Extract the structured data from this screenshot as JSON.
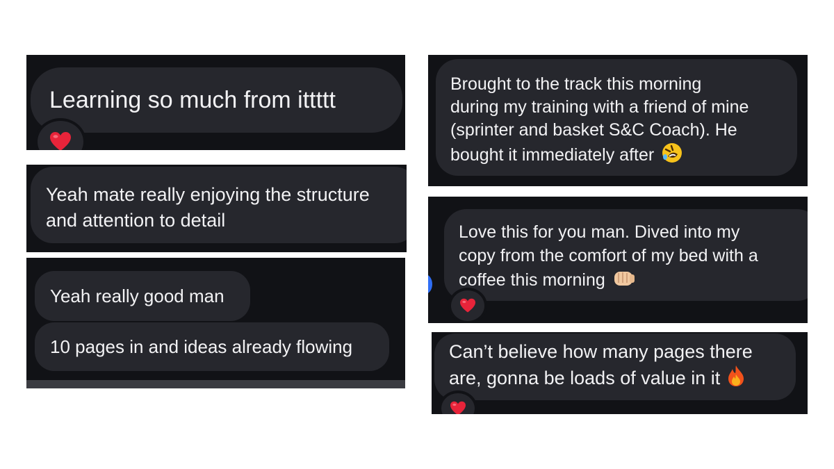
{
  "screenshots": [
    {
      "messages": [
        {
          "text": "Learning so much from ittttt",
          "reaction": "heart"
        }
      ]
    },
    {
      "messages": [
        {
          "lines": [
            "Yeah mate really enjoying the structure",
            "and attention to detail"
          ]
        }
      ]
    },
    {
      "messages": [
        {
          "text": "Yeah really good man"
        },
        {
          "text": "10 pages in and ideas already flowing"
        }
      ]
    },
    {
      "messages": [
        {
          "lines": [
            "Brought to the track this morning",
            "during my training with a friend of mine",
            "(sprinter and basket S&C Coach). He",
            "bought it immediately after"
          ],
          "emoji": "rolling-on-floor-laughing"
        }
      ]
    },
    {
      "messages": [
        {
          "lines": [
            "Love this for you man. Dived into my",
            "copy from the comfort of my bed with a",
            "coffee this morning"
          ],
          "emoji": "fist-bump",
          "reaction": "heart"
        }
      ]
    },
    {
      "messages": [
        {
          "lines": [
            "Can’t believe how many pages there",
            "are, gonna be loads of value in it"
          ],
          "emoji": "fire",
          "reaction": "heart"
        }
      ]
    }
  ],
  "colors": {
    "background": "#ffffff",
    "panel": "#111216",
    "bubble": "#26272d",
    "text": "#f2f2f4",
    "heart": "#e8243a"
  }
}
